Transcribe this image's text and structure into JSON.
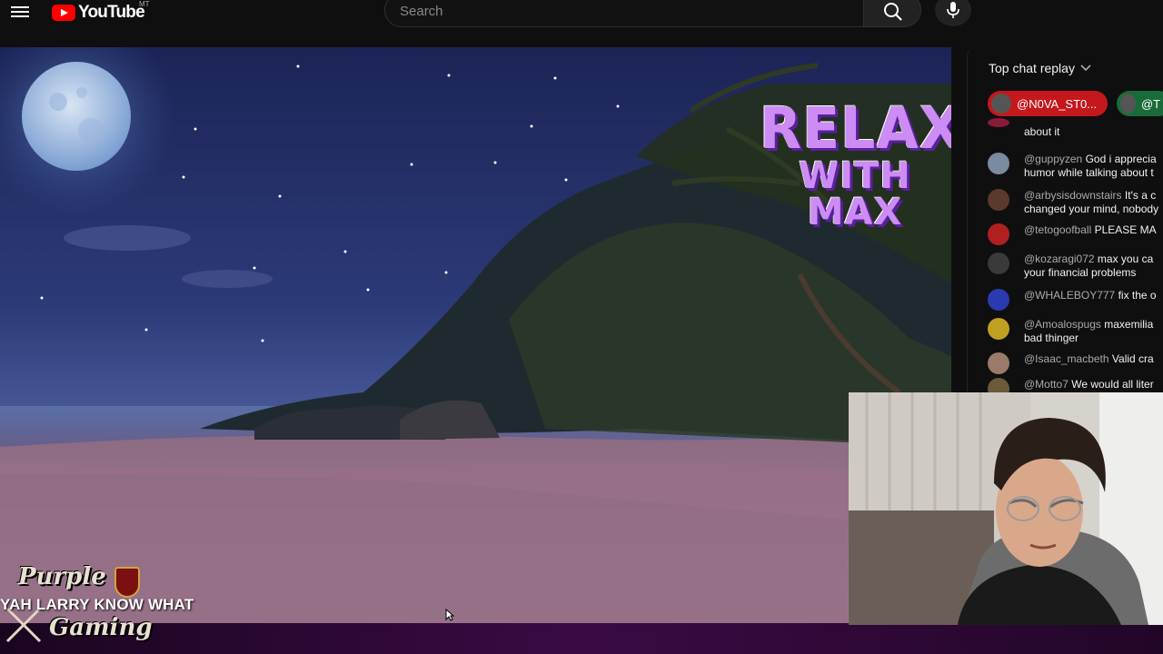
{
  "header": {
    "logo_text": "YouTube",
    "logo_region": "MT",
    "search_placeholder": "Search"
  },
  "video": {
    "brand_line1": "RELAX",
    "brand_line2": "WITH MAX",
    "channel_line1": "Purple",
    "channel_line2": "Gaming",
    "subtitle": "YAH LARRY KNOW WHAT"
  },
  "chat": {
    "title": "Top chat replay",
    "pinned": [
      {
        "name": "@N0VA_ST0...",
        "color": "#c4181d"
      },
      {
        "name": "@T",
        "color": "#1a6b3a"
      }
    ],
    "messages": [
      {
        "user": "",
        "line1": "about it",
        "line2": "",
        "avatar": "#8a1a3a"
      },
      {
        "user": "@guppyzen",
        "line1": "God i apprecia",
        "line2": "humor while talking about t",
        "avatar": "#7a8aa0"
      },
      {
        "user": "@arbysisdownstairs",
        "line1": "It's a c",
        "line2": "changed your mind, nobody",
        "avatar": "#5a3a2a"
      },
      {
        "user": "@tetogoofball",
        "line1": "PLEASE MA",
        "line2": "",
        "avatar": "#b02020"
      },
      {
        "user": "@kozaragi072",
        "line1": "max you ca",
        "line2": "your financial problems",
        "avatar": "#3a3a3a"
      },
      {
        "user": "@WHALEBOY777",
        "line1": "fix the o",
        "line2": "",
        "avatar": "#2a3ab0"
      },
      {
        "user": "@Amoalospugs",
        "line1": "maxemilia",
        "line2": "bad thinger",
        "avatar": "#c0a020"
      },
      {
        "user": "@Isaac_macbeth",
        "line1": "Valid cra",
        "line2": "",
        "avatar": "#9a7a6a"
      },
      {
        "user": "@Motto7",
        "line1": "We would all liter",
        "line2": "",
        "avatar": "#6a5a3a"
      }
    ]
  }
}
